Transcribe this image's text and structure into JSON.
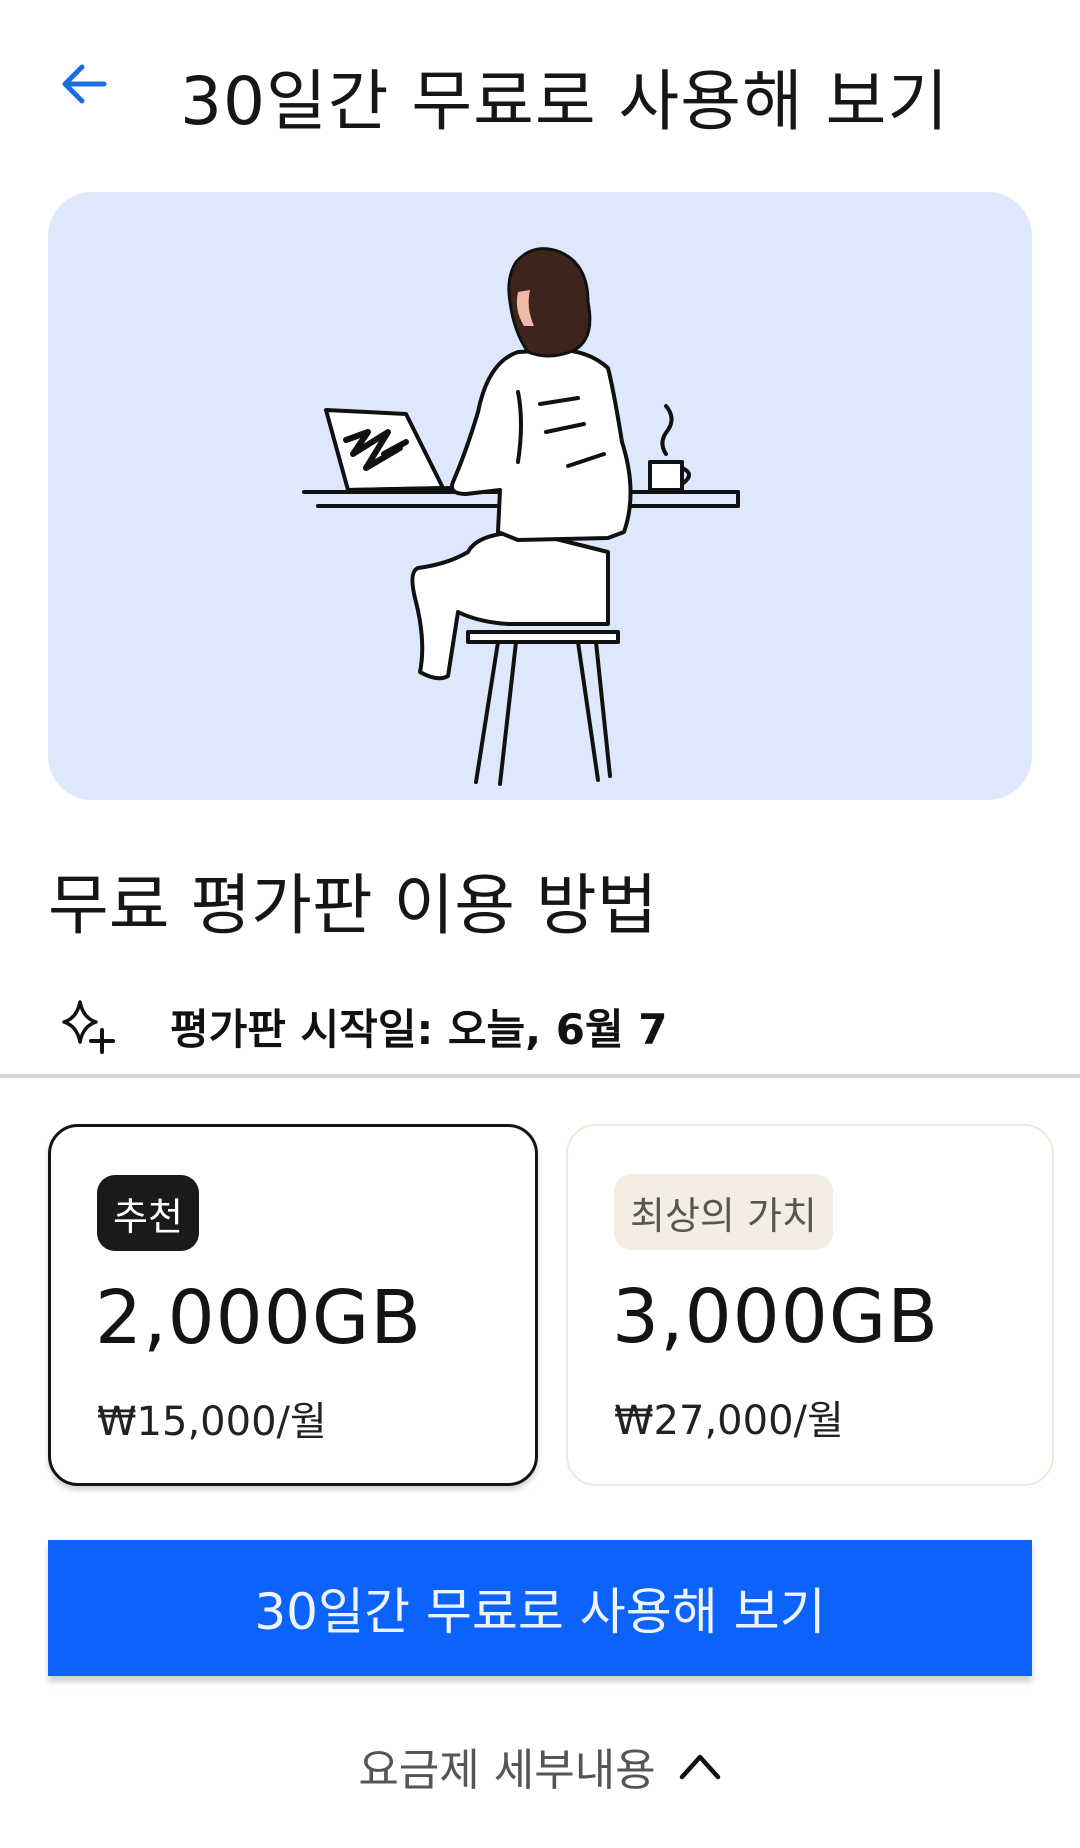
{
  "header": {
    "back_icon": "arrow-left-icon",
    "title": "30일간 무료로 사용해 보기"
  },
  "hero": {
    "illustration": "woman-at-laptop-illustration"
  },
  "section": {
    "title": "무료 평가판 이용 방법"
  },
  "trial": {
    "icon": "sparkle-icon",
    "start_text": "평가판 시작일: 오늘, 6월 7"
  },
  "plans": [
    {
      "badge": "추천",
      "size": "2,000GB",
      "price": "₩15,000/월",
      "selected": true
    },
    {
      "badge": "최상의 가치",
      "size": "3,000GB",
      "price": "₩27,000/월",
      "selected": false
    }
  ],
  "cta": {
    "label": "30일간 무료로 사용해 보기"
  },
  "details": {
    "label": "요금제 세부내용",
    "icon": "chevron-up-icon"
  },
  "colors": {
    "accent": "#0b63fb",
    "hero_bg": "#dde8fd",
    "badge_dark": "#1a1a1a",
    "badge_light": "#f3ede3"
  }
}
